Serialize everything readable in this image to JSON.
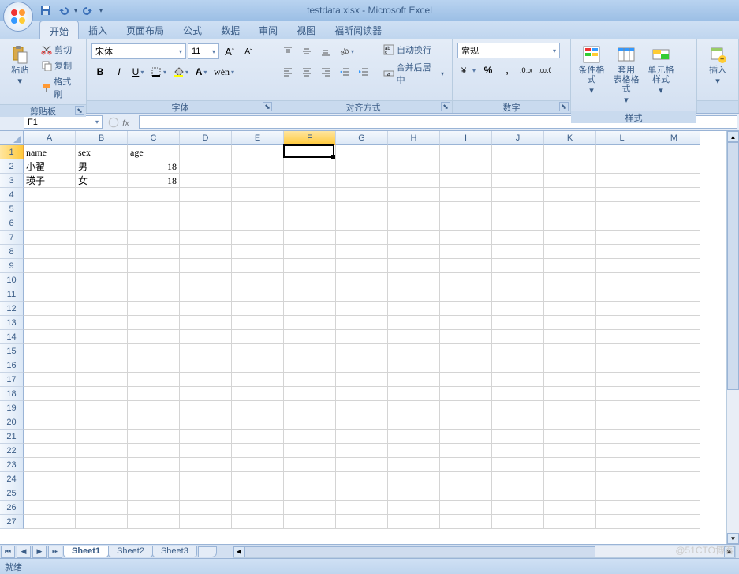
{
  "title": "testdata.xlsx - Microsoft Excel",
  "qat": {
    "save": "save",
    "undo": "undo",
    "redo": "redo"
  },
  "tabs": [
    "开始",
    "插入",
    "页面布局",
    "公式",
    "数据",
    "审阅",
    "视图",
    "福昕阅读器"
  ],
  "active_tab": 0,
  "ribbon": {
    "clipboard": {
      "label": "剪贴板",
      "paste": "粘贴",
      "cut": "剪切",
      "copy": "复制",
      "brush": "格式刷"
    },
    "font": {
      "label": "字体",
      "name": "宋体",
      "size": "11",
      "bold": "B",
      "italic": "I",
      "underline": "U"
    },
    "align": {
      "label": "对齐方式",
      "wrap": "自动换行",
      "merge": "合并后居中"
    },
    "number": {
      "label": "数字",
      "format": "常规"
    },
    "styles": {
      "label": "样式",
      "cond": "条件格式",
      "table": "套用\n表格格式",
      "cell": "单元格\n样式"
    },
    "insert": {
      "label": "",
      "btn": "插入"
    }
  },
  "namebox": "F1",
  "formula": "",
  "columns": [
    "A",
    "B",
    "C",
    "D",
    "E",
    "F",
    "G",
    "H",
    "I",
    "J",
    "K",
    "L",
    "M"
  ],
  "row_count": 27,
  "active": {
    "col": 5,
    "row": 0
  },
  "data": {
    "rows": [
      {
        "cells": [
          "name",
          "sex",
          "age"
        ]
      },
      {
        "cells": [
          "小翟",
          "男",
          "18"
        ],
        "numeric": [
          false,
          false,
          true
        ]
      },
      {
        "cells": [
          "瑛子",
          "女",
          "18"
        ],
        "numeric": [
          false,
          false,
          true
        ]
      }
    ]
  },
  "sheets": [
    "Sheet1",
    "Sheet2",
    "Sheet3"
  ],
  "active_sheet": 0,
  "status": "就绪",
  "watermark": "@51CTO博客"
}
